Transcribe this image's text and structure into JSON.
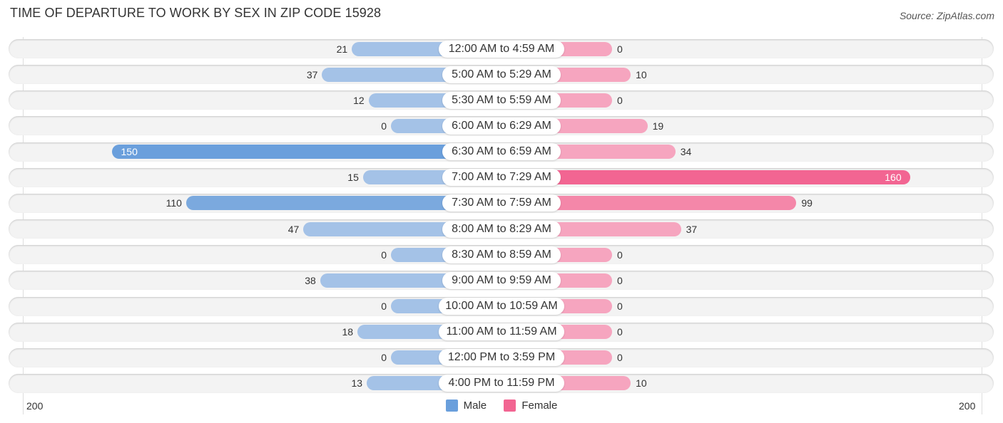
{
  "chart_data": {
    "type": "bar",
    "orientation": "horizontal-diverging",
    "title": "TIME OF DEPARTURE TO WORK BY SEX IN ZIP CODE 15928",
    "source": "Source: ZipAtlas.com",
    "categories": [
      "12:00 AM to 4:59 AM",
      "5:00 AM to 5:29 AM",
      "5:30 AM to 5:59 AM",
      "6:00 AM to 6:29 AM",
      "6:30 AM to 6:59 AM",
      "7:00 AM to 7:29 AM",
      "7:30 AM to 7:59 AM",
      "8:00 AM to 8:29 AM",
      "8:30 AM to 8:59 AM",
      "9:00 AM to 9:59 AM",
      "10:00 AM to 10:59 AM",
      "11:00 AM to 11:59 AM",
      "12:00 PM to 3:59 PM",
      "4:00 PM to 11:59 PM"
    ],
    "series": [
      {
        "name": "Male",
        "color": "#6a9fdc",
        "values": [
          21,
          37,
          12,
          0,
          150,
          15,
          110,
          47,
          0,
          38,
          0,
          18,
          0,
          13
        ]
      },
      {
        "name": "Female",
        "color": "#f26592",
        "values": [
          0,
          10,
          0,
          19,
          34,
          160,
          99,
          37,
          0,
          0,
          0,
          0,
          0,
          10
        ]
      }
    ],
    "xlim": [
      -200,
      200
    ],
    "axis_tick_labels": {
      "left": "200",
      "right": "200"
    },
    "legend": {
      "position": "bottom-center",
      "entries": [
        "Male",
        "Female"
      ]
    }
  }
}
